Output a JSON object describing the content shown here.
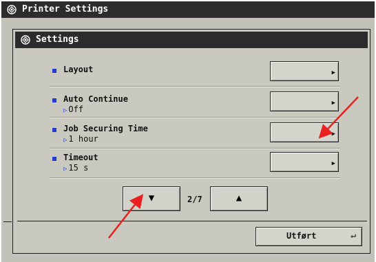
{
  "window": {
    "title": "Printer Settings"
  },
  "panel": {
    "title": "Settings"
  },
  "settings": [
    {
      "label": "Layout",
      "value": ""
    },
    {
      "label": "Auto Continue",
      "value": "Off"
    },
    {
      "label": "Job Securing Time",
      "value": "1 hour"
    },
    {
      "label": "Timeout",
      "value": "15 s"
    }
  ],
  "pagination": {
    "indicator": "2/7"
  },
  "footer": {
    "done_label": "Utført"
  },
  "icons": {
    "window_icon": "settings-icon",
    "row_action": "arrow-right-icon",
    "done_action": "return-icon"
  },
  "colors": {
    "title_bar": "#2c2c2c",
    "panel_bg": "#c9c9bf",
    "bullet": "#233bd1",
    "annotation_arrow": "#e82020"
  }
}
